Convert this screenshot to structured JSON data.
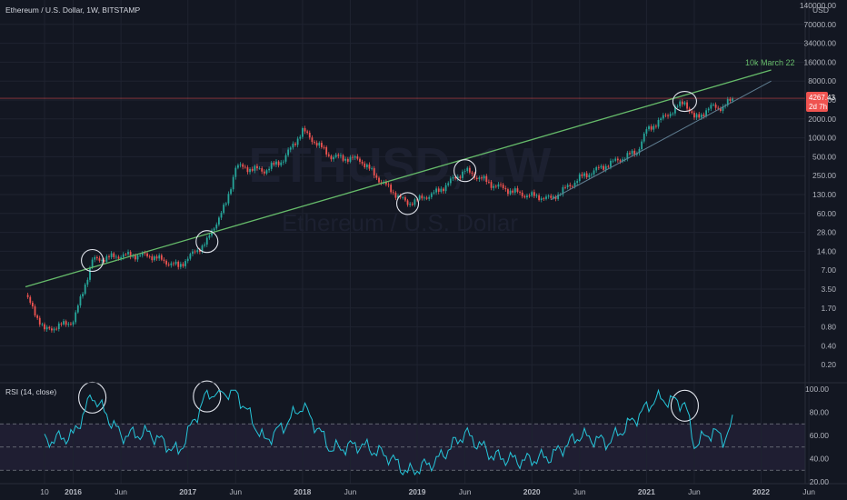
{
  "colors": {
    "background": "#131722",
    "grid": "#1f2330",
    "text": "#b2b5be",
    "up": "#26a69a",
    "down": "#ef5350",
    "trendline": "#66bb6a",
    "channel": "#5f7d91",
    "price_line": "#ef5350",
    "rsi_line": "#26c6da",
    "rsi_band": "#2a2440"
  },
  "header": {
    "title": "Ethereum / U.S. Dollar, 1W, BITSTAMP"
  },
  "watermark": {
    "symbol": "ETHUSD, 1W",
    "name": "Ethereum / U.S. Dollar"
  },
  "price_axis": {
    "currency": "USD",
    "ticks": [
      "140000.00",
      "70000.00",
      "34000.00",
      "16000.00",
      "8000.00",
      "4000.00",
      "2000.00",
      "1000.00",
      "500.00",
      "250.00",
      "130.00",
      "60.00",
      "28.00",
      "14.00",
      "7.00",
      "3.50",
      "1.70",
      "0.80",
      "0.40",
      "0.20"
    ]
  },
  "price_label": {
    "value": "4267.43",
    "countdown": "2d 7h"
  },
  "annotation": {
    "text": "10k March 22"
  },
  "rsi": {
    "label": "RSI (14, close)",
    "ticks": [
      "100.00",
      "80.00",
      "60.00",
      "40.00",
      "20.00"
    ],
    "upper": 70,
    "lower": 30,
    "middle": 50
  },
  "time_axis": {
    "ticks": [
      "10",
      "2016",
      "Jun",
      "2017",
      "Jun",
      "2018",
      "Jun",
      "2019",
      "Jun",
      "2020",
      "Jun",
      "2021",
      "Jun",
      "2022",
      "Jun"
    ]
  },
  "chart_data": [
    {
      "type": "candlestick",
      "title": "Ethereum / U.S. Dollar, 1W, BITSTAMP",
      "scale": "log",
      "ylabel": "USD",
      "ylim": [
        0.2,
        140000
      ],
      "x": [
        "2015-08",
        "2015-10",
        "2016-01",
        "2016-03",
        "2016-06",
        "2016-09",
        "2016-12",
        "2017-03",
        "2017-05",
        "2017-06",
        "2017-09",
        "2017-11",
        "2018-01",
        "2018-04",
        "2018-07",
        "2018-09",
        "2018-12",
        "2019-03",
        "2019-06",
        "2019-09",
        "2019-12",
        "2020-03",
        "2020-06",
        "2020-09",
        "2020-12",
        "2021-01",
        "2021-02",
        "2021-05",
        "2021-06",
        "2021-08",
        "2021-09",
        "2021-10"
      ],
      "close": [
        2.8,
        0.7,
        1.0,
        10.0,
        12.0,
        12.0,
        8.0,
        20.0,
        90.0,
        350.0,
        300.0,
        450.0,
        1300.0,
        500.0,
        450.0,
        220.0,
        90.0,
        140.0,
        300.0,
        180.0,
        130.0,
        110.0,
        230.0,
        380.0,
        600.0,
        1300.0,
        1700.0,
        3800.0,
        2000.0,
        3200.0,
        3000.0,
        4267.43
      ],
      "last_price": 4267.43,
      "trendline": {
        "label": "10k March 22",
        "target": 10000
      },
      "highlighted_points": [
        "2016-03",
        "2017-03",
        "2018-12",
        "2019-06",
        "2021-05"
      ]
    },
    {
      "type": "line",
      "title": "RSI (14, close)",
      "ylim": [
        20,
        100
      ],
      "x": [
        "2015-10",
        "2016-01",
        "2016-03",
        "2016-06",
        "2016-09",
        "2016-12",
        "2017-03",
        "2017-06",
        "2017-09",
        "2017-11",
        "2018-01",
        "2018-04",
        "2018-07",
        "2018-10",
        "2018-12",
        "2019-03",
        "2019-06",
        "2019-09",
        "2019-12",
        "2020-03",
        "2020-06",
        "2020-09",
        "2020-12",
        "2021-02",
        "2021-05",
        "2021-06",
        "2021-08",
        "2021-09",
        "2021-10"
      ],
      "y": [
        55,
        60,
        95,
        60,
        62,
        45,
        96,
        98,
        55,
        68,
        86,
        48,
        52,
        42,
        28,
        38,
        62,
        42,
        38,
        42,
        60,
        54,
        76,
        92,
        88,
        52,
        64,
        56,
        70
      ],
      "levels": [
        70,
        50,
        30
      ]
    }
  ]
}
